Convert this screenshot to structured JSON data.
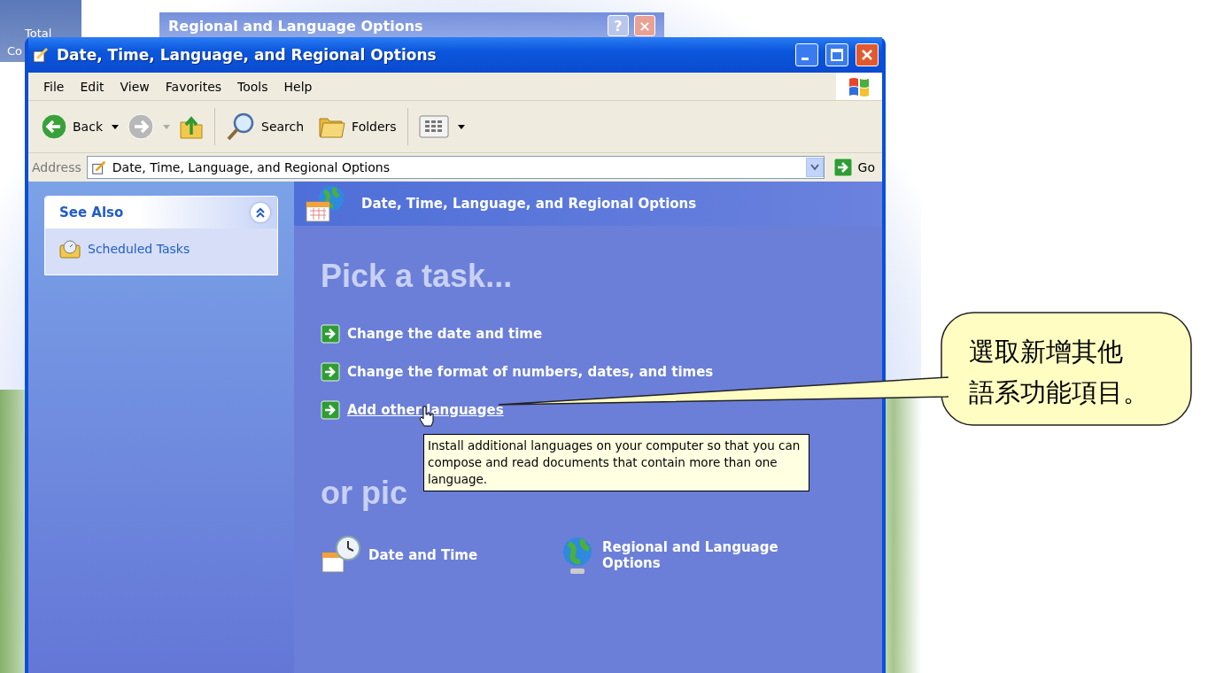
{
  "desktop": {
    "icon_labels": [
      "Total",
      "Co"
    ]
  },
  "back_window": {
    "title": "Regional and Language Options",
    "buttons": [
      "?",
      "×"
    ]
  },
  "window": {
    "title": "Date, Time, Language, and Regional Options"
  },
  "menu": [
    "File",
    "Edit",
    "View",
    "Favorites",
    "Tools",
    "Help"
  ],
  "toolbar": [
    {
      "kind": "back",
      "label": "Back",
      "disabled": false
    },
    {
      "kind": "forward",
      "disabled": true
    },
    {
      "kind": "up"
    },
    {
      "kind": "search",
      "label": "Search"
    },
    {
      "kind": "folders",
      "label": "Folders"
    },
    {
      "kind": "views"
    }
  ],
  "address": {
    "label": "Address",
    "value": "Date, Time, Language, and Regional Options",
    "go": "Go"
  },
  "see_also": {
    "title": "See Also",
    "expanded": true,
    "items": [
      "Scheduled Tasks"
    ]
  },
  "category": {
    "title": "Date, Time, Language, and Regional Options"
  },
  "tasks": {
    "heading": "Pick a task...",
    "items": [
      {
        "label": "Change the date and time",
        "hovered": false
      },
      {
        "label": "Change the format of numbers, dates, and times",
        "hovered": false
      },
      {
        "label": "Add other languages",
        "hovered": true
      }
    ]
  },
  "icons": {
    "heading": "or pic",
    "items": [
      {
        "kind": "clock",
        "label": "Date and Time"
      },
      {
        "kind": "globe",
        "label": "Regional and Language Options"
      }
    ]
  },
  "tooltip": "Install additional languages on your computer so that you can compose and read documents that contain more than one language.",
  "callout": {
    "lines": [
      "選取新增其他",
      "語系功能項目。"
    ]
  }
}
